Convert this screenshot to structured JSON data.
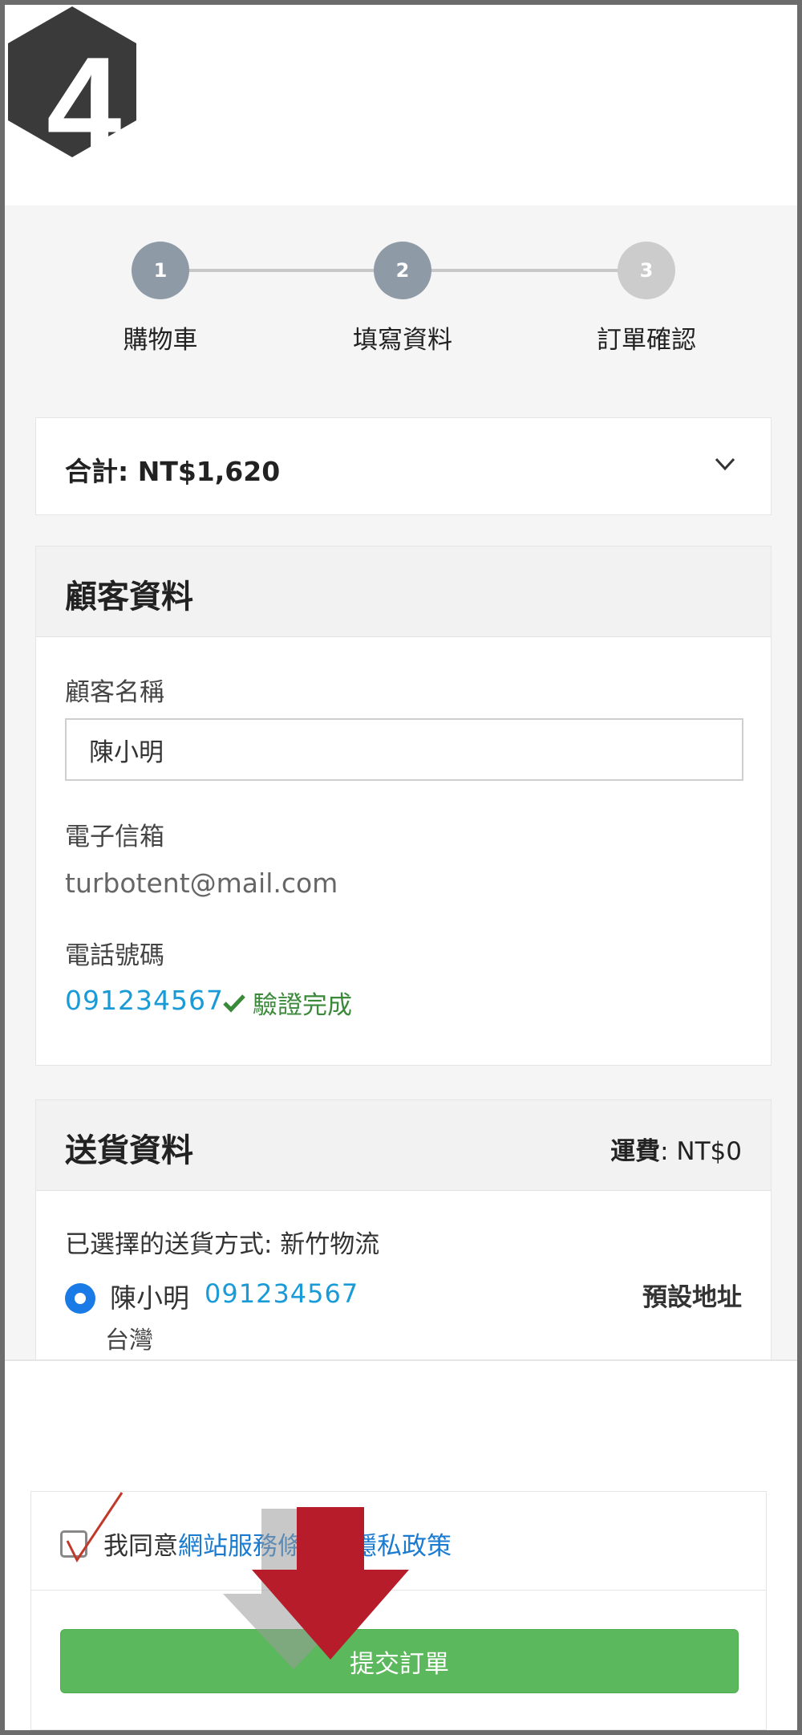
{
  "step_number": "4",
  "steps": [
    {
      "num": "1",
      "label": "購物車",
      "color": "#8e9aa6"
    },
    {
      "num": "2",
      "label": "填寫資料",
      "color": "#8e9aa6"
    },
    {
      "num": "3",
      "label": "訂單確認",
      "color": "#cccccc"
    }
  ],
  "summary": {
    "label": "合計:",
    "amount": "NT$1,620"
  },
  "customer": {
    "section_title": "顧客資料",
    "name_label": "顧客名稱",
    "name_value": "陳小明",
    "email_label": "電子信箱",
    "email_value": "turbotent@mail.com",
    "phone_label": "電話號碼",
    "phone_value": "091234567",
    "verified_text": "驗證完成"
  },
  "delivery": {
    "section_title": "送貨資料",
    "fee_label": "運費",
    "fee_value": ": NT$0",
    "method_text": "已選擇的送貨方式: 新竹物流",
    "recipient_name": "陳小明",
    "recipient_phone": "091234567",
    "default_tag": "預設地址",
    "country": "台灣"
  },
  "agreement": {
    "prefix": "我同意",
    "terms_link": "網站服務條款",
    "joiner": "及",
    "privacy_link": "隱私政策"
  },
  "submit_label": "提交訂單",
  "colors": {
    "accent_green": "#5cb85c",
    "link_blue": "#1a7bd1",
    "phone_blue": "#1a9bd7",
    "annotation_red": "#b71c2a"
  }
}
